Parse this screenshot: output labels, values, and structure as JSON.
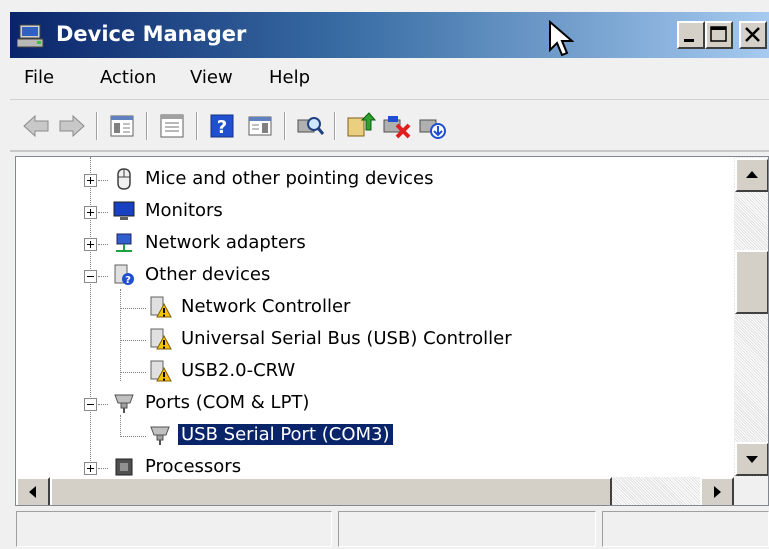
{
  "window": {
    "title": "Device Manager"
  },
  "menu": {
    "items": [
      "File",
      "Action",
      "View",
      "Help"
    ]
  },
  "toolbar": {
    "buttons": [
      "back-icon",
      "forward-icon",
      "show-hide-console-tree-icon",
      "properties-icon",
      "help-icon",
      "action-pane-icon",
      "scan-hardware-icon",
      "update-driver-icon",
      "uninstall-device-icon",
      "disable-device-icon"
    ]
  },
  "tree": {
    "rows": [
      {
        "label": "Mice and other pointing devices",
        "icon": "mouse-icon",
        "expander": "plus"
      },
      {
        "label": "Monitors",
        "icon": "monitor-icon",
        "expander": "plus"
      },
      {
        "label": "Network adapters",
        "icon": "network-adapter-icon",
        "expander": "plus"
      },
      {
        "label": "Other devices",
        "icon": "unknown-device-icon",
        "expander": "minus"
      },
      {
        "label": "Network Controller",
        "icon": "warning-device-icon",
        "expander": "none"
      },
      {
        "label": "Universal Serial Bus (USB) Controller",
        "icon": "warning-device-icon",
        "expander": "none"
      },
      {
        "label": "USB2.0-CRW",
        "icon": "warning-device-icon",
        "expander": "none"
      },
      {
        "label": "Ports (COM & LPT)",
        "icon": "port-icon",
        "expander": "minus"
      },
      {
        "label": "USB Serial Port (COM3)",
        "icon": "port-icon",
        "expander": "none",
        "selected": true
      },
      {
        "label": "Processors",
        "icon": "processor-icon",
        "expander": "plus"
      }
    ]
  },
  "statusbar": {
    "panes": [
      "",
      "",
      ""
    ]
  },
  "colors": {
    "title_gradient_start": "#0a246a",
    "title_gradient_end": "#a6caf0",
    "selection": "#0a246a",
    "warning": "#f5c400"
  }
}
